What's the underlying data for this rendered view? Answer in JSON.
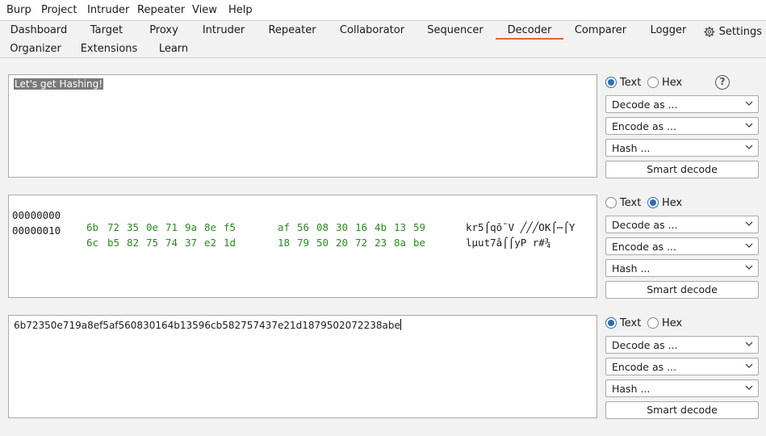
{
  "menu": [
    "Burp",
    "Project",
    "Intruder",
    "Repeater",
    "View",
    "Help"
  ],
  "tabs_row1": [
    "Dashboard",
    "Target",
    "Proxy",
    "Intruder",
    "Repeater",
    "Collaborator",
    "Sequencer",
    "Decoder",
    "Comparer",
    "Logger"
  ],
  "settings_label": "Settings",
  "tabs_row2": [
    "Organizer",
    "Extensions",
    "Learn"
  ],
  "active_tab": "Decoder",
  "panels": [
    {
      "text": "Let's get Hashing!",
      "mode": "Text",
      "text_label": "Text",
      "hex_label": "Hex",
      "decode": "Decode as ...",
      "encode": "Encode as ...",
      "hash": "Hash ...",
      "smart": "Smart decode"
    },
    {
      "mode": "Hex",
      "hex_rows": [
        {
          "offset": "00000000",
          "bytes": [
            "6b",
            "72",
            "35",
            "0e",
            "71",
            "9a",
            "8e",
            "f5",
            "af",
            "56",
            "08",
            "30",
            "16",
            "4b",
            "13",
            "59"
          ],
          "ascii": "kr5⌠qõ¯V ╱╱╱OK⌠⋯⌠Y"
        },
        {
          "offset": "00000010",
          "bytes": [
            "6c",
            "b5",
            "82",
            "75",
            "74",
            "37",
            "e2",
            "1d",
            "18",
            "79",
            "50",
            "20",
            "72",
            "23",
            "8a",
            "be"
          ],
          "ascii": "lµut7â⌠⌠yP r#¾"
        }
      ],
      "text_label": "Text",
      "hex_label": "Hex",
      "decode": "Decode as ...",
      "encode": "Encode as ...",
      "hash": "Hash ...",
      "smart": "Smart decode"
    },
    {
      "text": "6b72350e719a8ef5af560830164b13596cb582757437e21d1879502072238abe",
      "mode": "Text",
      "text_label": "Text",
      "hex_label": "Hex",
      "decode": "Decode as ...",
      "encode": "Encode as ...",
      "hash": "Hash ...",
      "smart": "Smart decode"
    }
  ],
  "colors": {
    "active_tab_underline": "#e8622a",
    "hex_bytes": "#2a8a1f",
    "radio_selected": "#2d6cb5"
  }
}
